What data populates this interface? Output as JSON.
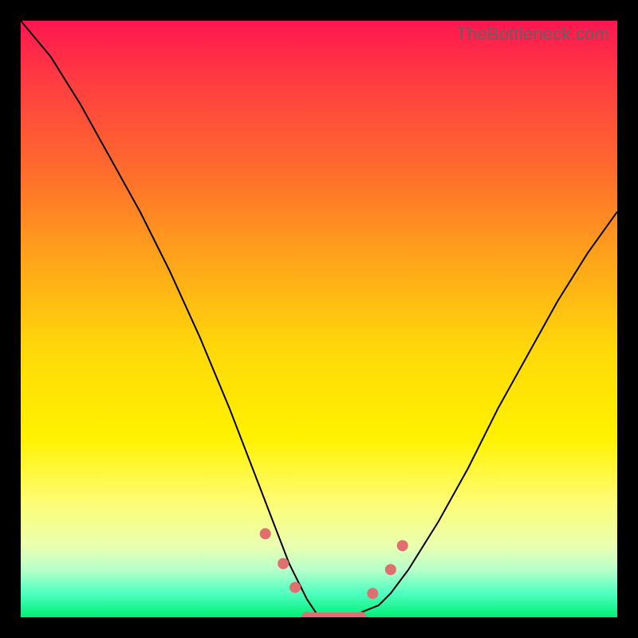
{
  "watermark": "TheBottleneck.com",
  "chart_data": {
    "type": "line",
    "title": "",
    "xlabel": "",
    "ylabel": "",
    "xlim": [
      0,
      100
    ],
    "ylim": [
      0,
      100
    ],
    "background": "rainbow-vertical-gradient",
    "series": [
      {
        "name": "bottleneck-curve",
        "stroke": "#000000",
        "x": [
          0,
          5,
          10,
          15,
          20,
          25,
          30,
          35,
          40,
          45,
          48,
          50,
          55,
          60,
          62,
          65,
          70,
          75,
          80,
          85,
          90,
          95,
          100
        ],
        "y": [
          100,
          94,
          86,
          77,
          68,
          58,
          47,
          35,
          22,
          9,
          3,
          0,
          0,
          2,
          4,
          8,
          16,
          25,
          35,
          44,
          53,
          61,
          68
        ]
      }
    ],
    "markers": [
      {
        "x": 41,
        "y": 14
      },
      {
        "x": 44,
        "y": 9
      },
      {
        "x": 46,
        "y": 5
      },
      {
        "x": 59,
        "y": 4
      },
      {
        "x": 62,
        "y": 8
      },
      {
        "x": 64,
        "y": 12
      }
    ],
    "flat_segment": {
      "x_start": 48,
      "x_end": 57,
      "y": 0
    }
  }
}
